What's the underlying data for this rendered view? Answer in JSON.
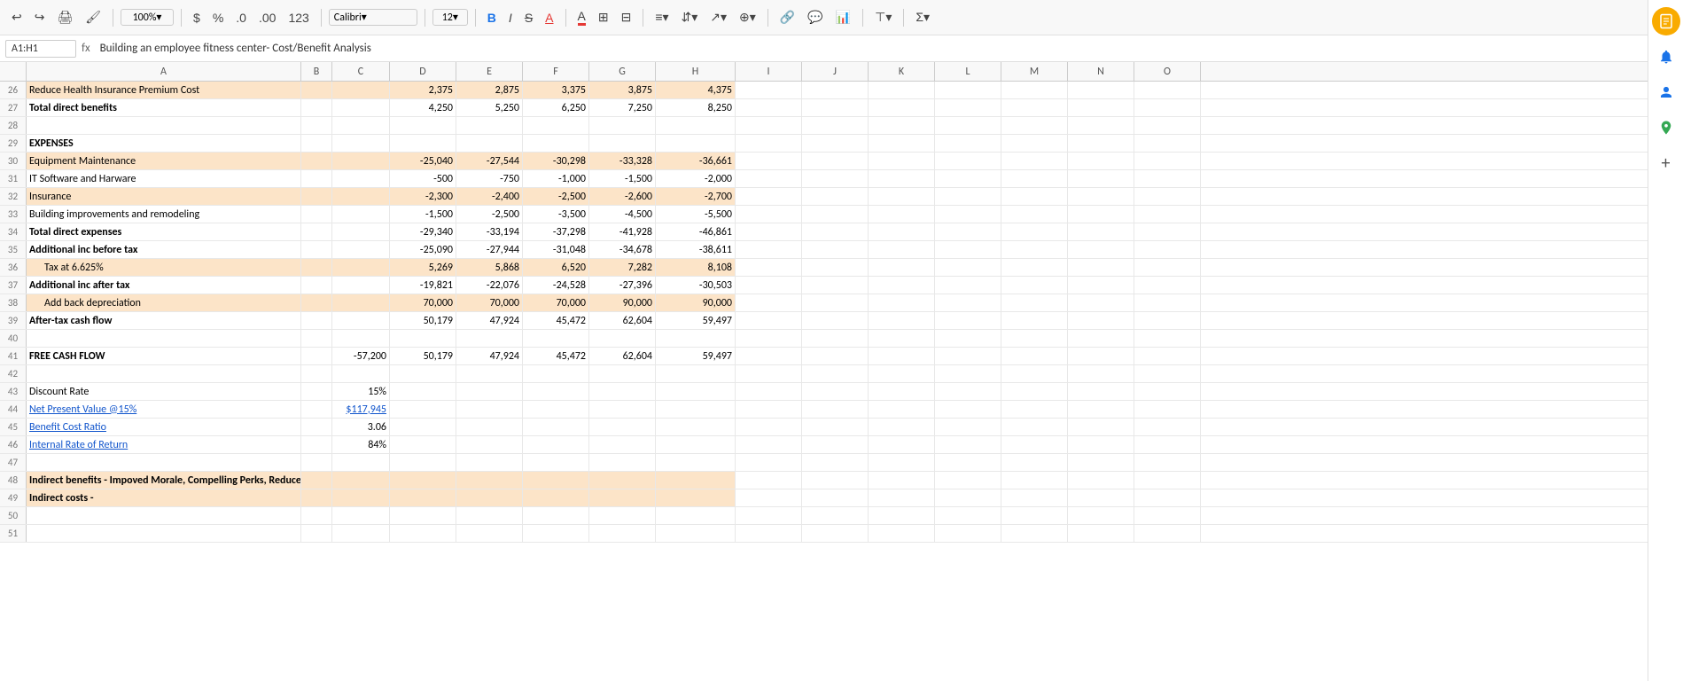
{
  "toolbar": {
    "undo": "↩",
    "redo": "↪",
    "print": "🖨",
    "format_paint": "🖌",
    "zoom": "100%",
    "currency": "$",
    "percent": "%",
    "dec_decrease": ".0",
    "dec_increase": ".00",
    "more_formats": "123",
    "font": "Calibri",
    "font_size": "12",
    "bold": "B",
    "italic": "I",
    "strikethrough": "S",
    "underline": "A",
    "fill_color": "A",
    "borders": "⊞",
    "merge": "⊟",
    "text_align": "≡",
    "vert_align": "⇵",
    "text_rotate": "↗",
    "more_align": "▾",
    "link": "🔗",
    "comment": "💬",
    "chart": "📊",
    "filter": "⊤",
    "function": "Σ"
  },
  "formula_bar": {
    "cell_ref": "A1:H1",
    "fx": "fx",
    "formula": "Building an employee fitness center- Cost/Benefit Analysis"
  },
  "columns": [
    "",
    "A",
    "B",
    "C",
    "D",
    "E",
    "F",
    "G",
    "H",
    "I",
    "J",
    "K",
    "L",
    "M",
    "N",
    "O"
  ],
  "rows": [
    {
      "num": 26,
      "cells": {
        "a": "Reduce Health Insurance Premium Cost",
        "b": "",
        "c": "",
        "d": "2,375",
        "e": "2,875",
        "f": "3,375",
        "g": "3,875",
        "h": "4,375",
        "bg": "orange"
      }
    },
    {
      "num": 27,
      "cells": {
        "a": "Total direct benefits",
        "b": "",
        "c": "",
        "d": "4,250",
        "e": "5,250",
        "f": "6,250",
        "g": "7,250",
        "h": "8,250",
        "bg": "none"
      },
      "bold_a": true
    },
    {
      "num": 28,
      "cells": {
        "a": "",
        "b": "",
        "c": "",
        "d": "",
        "e": "",
        "f": "",
        "g": "",
        "h": "",
        "bg": "none"
      }
    },
    {
      "num": 29,
      "cells": {
        "a": "EXPENSES",
        "b": "",
        "c": "",
        "d": "",
        "e": "",
        "f": "",
        "g": "",
        "h": "",
        "bg": "none"
      },
      "bold_a": true
    },
    {
      "num": 30,
      "cells": {
        "a": "Equipment Maintenance",
        "b": "",
        "c": "",
        "d": "-25,040",
        "e": "-27,544",
        "f": "-30,298",
        "g": "-33,328",
        "h": "-36,661",
        "bg": "orange"
      }
    },
    {
      "num": 31,
      "cells": {
        "a": "IT Software and Harware",
        "b": "",
        "c": "",
        "d": "-500",
        "e": "-750",
        "f": "-1,000",
        "g": "-1,500",
        "h": "-2,000",
        "bg": "none"
      }
    },
    {
      "num": 32,
      "cells": {
        "a": "Insurance",
        "b": "",
        "c": "",
        "d": "-2,300",
        "e": "-2,400",
        "f": "-2,500",
        "g": "-2,600",
        "h": "-2,700",
        "bg": "orange"
      }
    },
    {
      "num": 33,
      "cells": {
        "a": "Building improvements and remodeling",
        "b": "",
        "c": "",
        "d": "-1,500",
        "e": "-2,500",
        "f": "-3,500",
        "g": "-4,500",
        "h": "-5,500",
        "bg": "none"
      }
    },
    {
      "num": 34,
      "cells": {
        "a": "Total direct expenses",
        "b": "",
        "c": "",
        "d": "-29,340",
        "e": "-33,194",
        "f": "-37,298",
        "g": "-41,928",
        "h": "-46,861",
        "bg": "none"
      },
      "bold_a": true
    },
    {
      "num": 35,
      "cells": {
        "a": "Additional inc before tax",
        "b": "",
        "c": "",
        "d": "-25,090",
        "e": "-27,944",
        "f": "-31,048",
        "g": "-34,678",
        "h": "-38,611",
        "bg": "none"
      },
      "bold_a": true
    },
    {
      "num": 36,
      "cells": {
        "a": "  Tax at 6.625%",
        "b": "",
        "c": "",
        "d": "5,269",
        "e": "5,868",
        "f": "6,520",
        "g": "7,282",
        "h": "8,108",
        "bg": "orange",
        "indent": true
      }
    },
    {
      "num": 37,
      "cells": {
        "a": "Additional inc after tax",
        "b": "",
        "c": "",
        "d": "-19,821",
        "e": "-22,076",
        "f": "-24,528",
        "g": "-27,396",
        "h": "-30,503",
        "bg": "none"
      },
      "bold_a": true
    },
    {
      "num": 38,
      "cells": {
        "a": "  Add back depreciation",
        "b": "",
        "c": "",
        "d": "70,000",
        "e": "70,000",
        "f": "70,000",
        "g": "90,000",
        "h": "90,000",
        "bg": "orange",
        "indent": true
      }
    },
    {
      "num": 39,
      "cells": {
        "a": "After-tax cash flow",
        "b": "",
        "c": "",
        "d": "50,179",
        "e": "47,924",
        "f": "45,472",
        "g": "62,604",
        "h": "59,497",
        "bg": "none"
      },
      "bold_a": true
    },
    {
      "num": 40,
      "cells": {
        "a": "",
        "b": "",
        "c": "",
        "d": "",
        "e": "",
        "f": "",
        "g": "",
        "h": "",
        "bg": "none"
      }
    },
    {
      "num": 41,
      "cells": {
        "a": "FREE CASH FLOW",
        "b": "",
        "c": "-57,200",
        "d": "50,179",
        "e": "47,924",
        "f": "45,472",
        "g": "62,604",
        "h": "59,497",
        "bg": "none"
      },
      "bold_a": true
    },
    {
      "num": 42,
      "cells": {
        "a": "",
        "b": "",
        "c": "",
        "d": "",
        "e": "",
        "f": "",
        "g": "",
        "h": "",
        "bg": "none"
      }
    },
    {
      "num": 43,
      "cells": {
        "a": "Discount Rate",
        "b": "",
        "c": "15%",
        "d": "",
        "e": "",
        "f": "",
        "g": "",
        "h": "",
        "bg": "none"
      }
    },
    {
      "num": 44,
      "cells": {
        "a": "Net Present Value @15%",
        "b": "",
        "c": "$117,945",
        "d": "",
        "e": "",
        "f": "",
        "g": "",
        "h": "",
        "bg": "none",
        "blue_a": true,
        "blue_c": true
      }
    },
    {
      "num": 45,
      "cells": {
        "a": "Benefit Cost Ratio",
        "b": "",
        "c": "3.06",
        "d": "",
        "e": "",
        "f": "",
        "g": "",
        "h": "",
        "bg": "none",
        "blue_a": true
      }
    },
    {
      "num": 46,
      "cells": {
        "a": "Internal Rate of Return",
        "b": "",
        "c": "84%",
        "d": "",
        "e": "",
        "f": "",
        "g": "",
        "h": "",
        "bg": "none",
        "blue_a": true
      }
    },
    {
      "num": 47,
      "cells": {
        "a": "",
        "b": "",
        "c": "",
        "d": "",
        "e": "",
        "f": "",
        "g": "",
        "h": "",
        "bg": "none"
      }
    },
    {
      "num": 48,
      "cells": {
        "a": "Indirect benefits - Impoved Morale, Compelling Perks, Reduce Sick Time,and More energized staff",
        "b": "",
        "c": "",
        "d": "",
        "e": "",
        "f": "",
        "g": "",
        "h": "",
        "bg": "orange"
      },
      "bold_a": true
    },
    {
      "num": 49,
      "cells": {
        "a": "Indirect costs -",
        "b": "",
        "c": "",
        "d": "",
        "e": "",
        "f": "",
        "g": "",
        "h": "",
        "bg": "orange"
      },
      "bold_a": true
    },
    {
      "num": 50,
      "cells": {
        "a": "",
        "b": "",
        "c": "",
        "d": "",
        "e": "",
        "f": "",
        "g": "",
        "h": "",
        "bg": "none"
      }
    },
    {
      "num": 51,
      "cells": {
        "a": "",
        "b": "",
        "c": "",
        "d": "",
        "e": "",
        "f": "",
        "g": "",
        "h": "",
        "bg": "none"
      }
    }
  ],
  "sidebar_icons": {
    "google_sheets": "📋",
    "notifications": "🔔",
    "account": "👤",
    "maps": "📍"
  }
}
